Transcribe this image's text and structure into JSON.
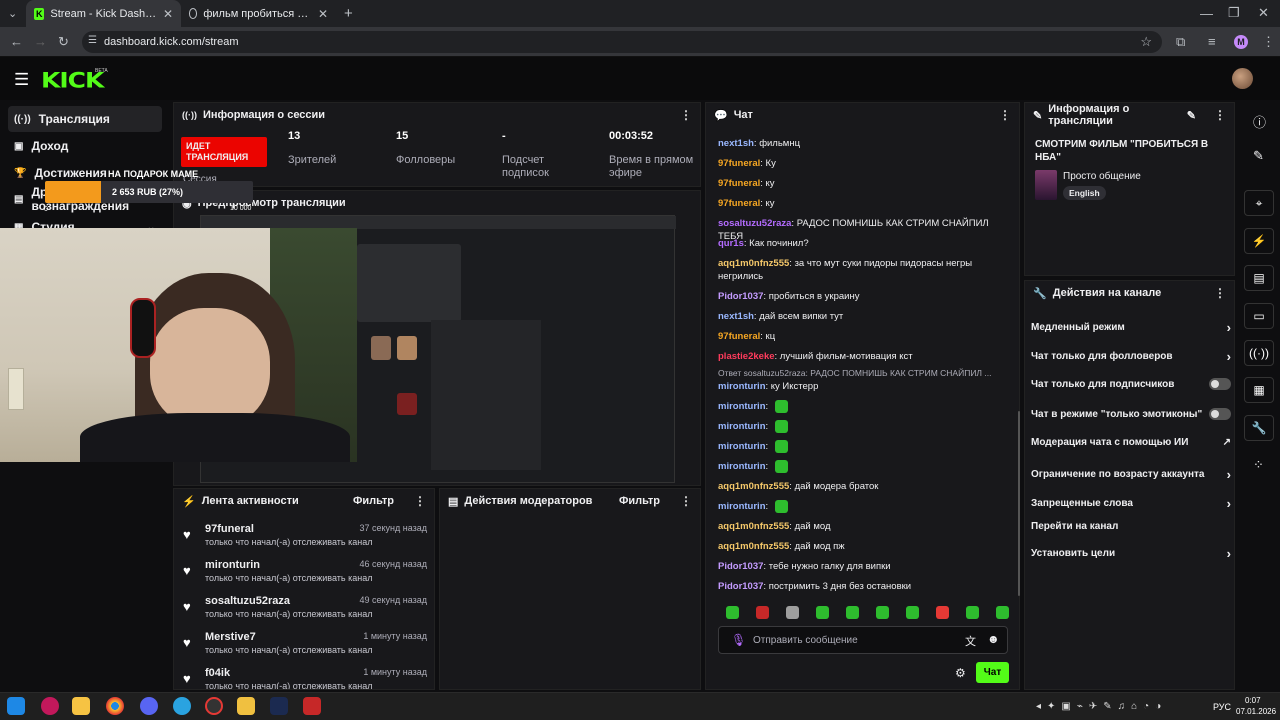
{
  "browser": {
    "tabs": [
      {
        "title": "Stream - Kick Dashboard",
        "icon": "kick-favicon-icon"
      },
      {
        "title": "фильм пробиться в нба смотр",
        "icon": "globe-icon"
      }
    ],
    "url": "dashboard.kick.com/stream",
    "profile_initial": "M"
  },
  "brand": {
    "logo": "KICK",
    "badge": "BETA"
  },
  "sidebar": {
    "items": [
      {
        "label": "Трансляция",
        "icon": "broadcast-icon"
      },
      {
        "label": "Доход",
        "icon": "wallet-icon"
      },
      {
        "label": "Достижения",
        "icon": "trophy-icon"
      },
      {
        "label": "Дропы и вознаграждения",
        "icon": "gift-icon"
      },
      {
        "label": "Студия",
        "icon": "studio-icon"
      }
    ]
  },
  "donation_overlay": {
    "goal_label": "НА ПОДАРОК MAME",
    "amount": "2 653 RUB (27%)",
    "progress": 0.27,
    "goal_target": "10 000",
    "zero": "0"
  },
  "session": {
    "title": "Информация о сессии",
    "live_badge": "ИДЕТ ТРАНСЛЯЦИЯ",
    "session_label": "Сессия",
    "stats": [
      {
        "value": "13",
        "label": "Зрителей"
      },
      {
        "value": "15",
        "label": "Фолловеры"
      },
      {
        "value": "-",
        "label": "Подсчет подписок"
      },
      {
        "value": "00:03:52",
        "label": "Время в прямом эфире"
      }
    ]
  },
  "preview": {
    "title": "Предпросмотр трансляции"
  },
  "activity": {
    "title": "Лента активности",
    "filter": "Фильтр",
    "items": [
      {
        "name": "97funeral",
        "time": "37 секунд назад",
        "desc": "только что начал(-а) отслеживать канал"
      },
      {
        "name": "mironturin",
        "time": "46 секунд назад",
        "desc": "только что начал(-а) отслеживать канал"
      },
      {
        "name": "sosaltuzu52raza",
        "time": "49 секунд назад",
        "desc": "только что начал(-а) отслеживать канал"
      },
      {
        "name": "Merstive7",
        "time": "1 минуту назад",
        "desc": "только что начал(-а) отслеживать канал"
      },
      {
        "name": "f04ik",
        "time": "1 минуту назад",
        "desc": "только что начал(-а) отслеживать канал"
      }
    ]
  },
  "moderators": {
    "title": "Действия модераторов",
    "filter": "Фильтр"
  },
  "chat": {
    "title": "Чат",
    "messages": [
      {
        "user": "next1sh",
        "color": "#9ab8ff",
        "text": "фильмнц"
      },
      {
        "user": "97funeral",
        "color": "#f5a623",
        "text": "Ку"
      },
      {
        "user": "97funeral",
        "color": "#f5a623",
        "text": "ку"
      },
      {
        "user": "97funeral",
        "color": "#f5a623",
        "text": "ку"
      },
      {
        "user": "sosaltuzu52raza",
        "color": "#b46cff",
        "text": "РАДОС ПОМНИШЬ КАК СТРИМ СНАЙПИЛ ТЕБЯ"
      },
      {
        "user": "qur1s",
        "color": "#b46cff",
        "text": "Как починил?"
      },
      {
        "user": "aqq1m0nfnz555",
        "color": "#f5c86a",
        "text": "за что мут суки пидоры пидорасы негры негрились"
      },
      {
        "user": "Pidor1037",
        "color": "#c49bff",
        "text": "пробиться в украину"
      },
      {
        "user": "next1sh",
        "color": "#9ab8ff",
        "text": "дай всем випки тут"
      },
      {
        "user": "97funeral",
        "color": "#f5a623",
        "text": "кц"
      },
      {
        "user": "plastie2keke",
        "color": "#ff3b5c",
        "text": "лучший фильм-мотивация кст"
      },
      {
        "user": "mironturin",
        "color": "#9ab8ff",
        "text": "ку Икстерр",
        "reply": "Ответ sosaltuzu52raza: РАДОС ПОМНИШЬ КАК СТРИМ СНАЙПИЛ ..."
      },
      {
        "user": "mironturin",
        "color": "#9ab8ff",
        "text": "",
        "emote": true
      },
      {
        "user": "mironturin",
        "color": "#9ab8ff",
        "text": "",
        "emote": true
      },
      {
        "user": "mironturin",
        "color": "#9ab8ff",
        "text": "",
        "emote": true
      },
      {
        "user": "mironturin",
        "color": "#9ab8ff",
        "text": "",
        "emote": true
      },
      {
        "user": "aqq1m0nfnz555",
        "color": "#f5c86a",
        "text": "дай модера браток"
      },
      {
        "user": "mironturin",
        "color": "#9ab8ff",
        "text": "",
        "emote": true
      },
      {
        "user": "aqq1m0nfnz555",
        "color": "#f5c86a",
        "text": "дай мод"
      },
      {
        "user": "aqq1m0nfnz555",
        "color": "#f5c86a",
        "text": "дай мод пж"
      },
      {
        "user": "Pidor1037",
        "color": "#c49bff",
        "text": "тебе нужно галку для випки"
      },
      {
        "user": "Pidor1037",
        "color": "#c49bff",
        "text": "постримить 3 дня без остановки"
      }
    ],
    "input_placeholder": "Отправить сообщение",
    "send_label": "Чат"
  },
  "stream_info": {
    "title": "Информация о трансляции",
    "stream_title": "СМОТРИМ ФИЛЬМ \"ПРОБИТЬСЯ В НБА\"",
    "category": "Просто общение",
    "language": "English"
  },
  "channel_actions": {
    "title": "Действия на канале",
    "items": [
      {
        "label": "Медленный режим",
        "control": "chevron"
      },
      {
        "label": "Чат только для фолловеров",
        "control": "chevron"
      },
      {
        "label": "Чат только для подписчиков",
        "control": "toggle"
      },
      {
        "label": "Чат в режиме \"только эмотиконы\"",
        "control": "toggle"
      },
      {
        "label": "Модерация чата с помощью ИИ",
        "control": "external"
      },
      {
        "label": "Ограничение по возрасту аккаунта",
        "control": "chevron"
      },
      {
        "label": "Запрещенные слова",
        "control": "chevron"
      },
      {
        "label": "Перейти на канал",
        "control": "none"
      },
      {
        "label": "Установить цели",
        "control": "chevron"
      }
    ]
  },
  "taskbar": {
    "lang": "РУС",
    "time": "0:07",
    "date": "07.01.2026"
  },
  "colors": {
    "accent": "#53fc18",
    "live": "#eb0400",
    "panel": "#18181b",
    "bg": "#0e0e10"
  }
}
